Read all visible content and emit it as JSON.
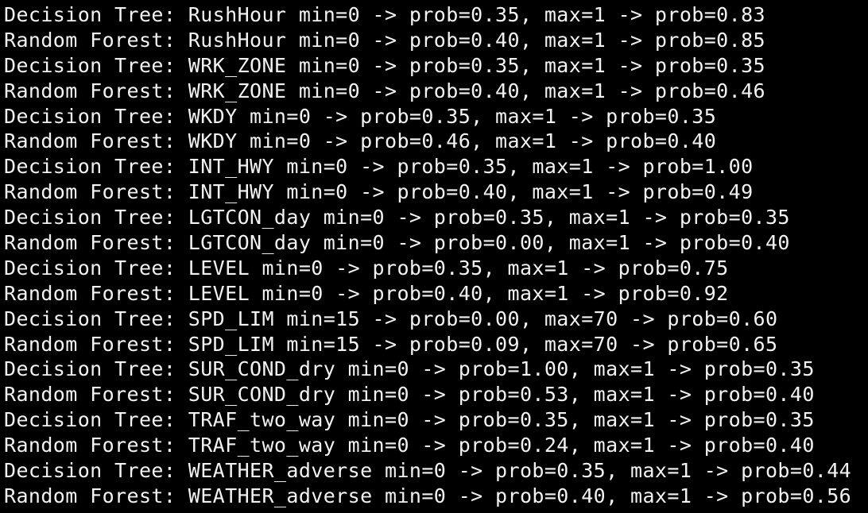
{
  "terminal": {
    "background": "#000000",
    "foreground": "#f2f2f2",
    "lines": [
      "Decision Tree: RushHour min=0 -> prob=0.35, max=1 -> prob=0.83",
      "Random Forest: RushHour min=0 -> prob=0.40, max=1 -> prob=0.85",
      "Decision Tree: WRK_ZONE min=0 -> prob=0.35, max=1 -> prob=0.35",
      "Random Forest: WRK_ZONE min=0 -> prob=0.40, max=1 -> prob=0.46",
      "Decision Tree: WKDY min=0 -> prob=0.35, max=1 -> prob=0.35",
      "Random Forest: WKDY min=0 -> prob=0.46, max=1 -> prob=0.40",
      "Decision Tree: INT_HWY min=0 -> prob=0.35, max=1 -> prob=1.00",
      "Random Forest: INT_HWY min=0 -> prob=0.40, max=1 -> prob=0.49",
      "Decision Tree: LGTCON_day min=0 -> prob=0.35, max=1 -> prob=0.35",
      "Random Forest: LGTCON_day min=0 -> prob=0.00, max=1 -> prob=0.40",
      "Decision Tree: LEVEL min=0 -> prob=0.35, max=1 -> prob=0.75",
      "Random Forest: LEVEL min=0 -> prob=0.40, max=1 -> prob=0.92",
      "Decision Tree: SPD_LIM min=15 -> prob=0.00, max=70 -> prob=0.60",
      "Random Forest: SPD_LIM min=15 -> prob=0.09, max=70 -> prob=0.65",
      "Decision Tree: SUR_COND_dry min=0 -> prob=1.00, max=1 -> prob=0.35",
      "Random Forest: SUR_COND_dry min=0 -> prob=0.53, max=1 -> prob=0.40",
      "Decision Tree: TRAF_two_way min=0 -> prob=0.35, max=1 -> prob=0.35",
      "Random Forest: TRAF_two_way min=0 -> prob=0.24, max=1 -> prob=0.40",
      "Decision Tree: WEATHER_adverse min=0 -> prob=0.35, max=1 -> prob=0.44",
      "Random Forest: WEATHER_adverse min=0 -> prob=0.40, max=1 -> prob=0.56"
    ]
  }
}
